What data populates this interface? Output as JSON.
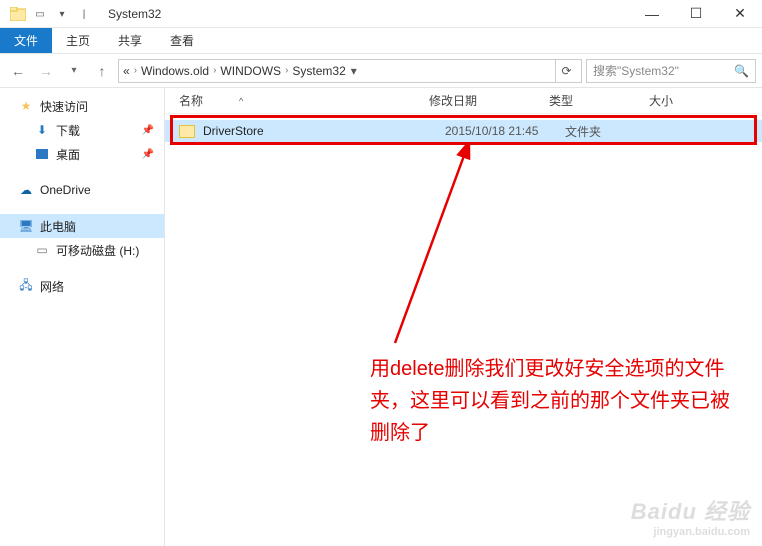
{
  "window": {
    "title": "System32",
    "minimize": "—",
    "maximize": "☐",
    "close": "✕"
  },
  "ribbon": {
    "file": "文件",
    "home": "主页",
    "share": "共享",
    "view": "查看"
  },
  "breadcrumb": {
    "prefix": "«",
    "seg1": "Windows.old",
    "seg2": "WINDOWS",
    "seg3": "System32"
  },
  "search": {
    "placeholder": "搜索\"System32\""
  },
  "sidebar": {
    "quick": "快速访问",
    "downloads": "下载",
    "desktop": "桌面",
    "onedrive": "OneDrive",
    "thispc": "此电脑",
    "removable": "可移动磁盘 (H:)",
    "network": "网络"
  },
  "columns": {
    "name": "名称",
    "date": "修改日期",
    "type": "类型",
    "size": "大小"
  },
  "file": {
    "name": "DriverStore",
    "date": "2015/10/18 21:45",
    "type": "文件夹"
  },
  "annotation": {
    "text": "用delete删除我们更改好安全选项的文件夹，这里可以看到之前的那个文件夹已被删除了"
  },
  "watermark": {
    "main": "Baidu 经验",
    "sub": "jingyan.baidu.com"
  }
}
